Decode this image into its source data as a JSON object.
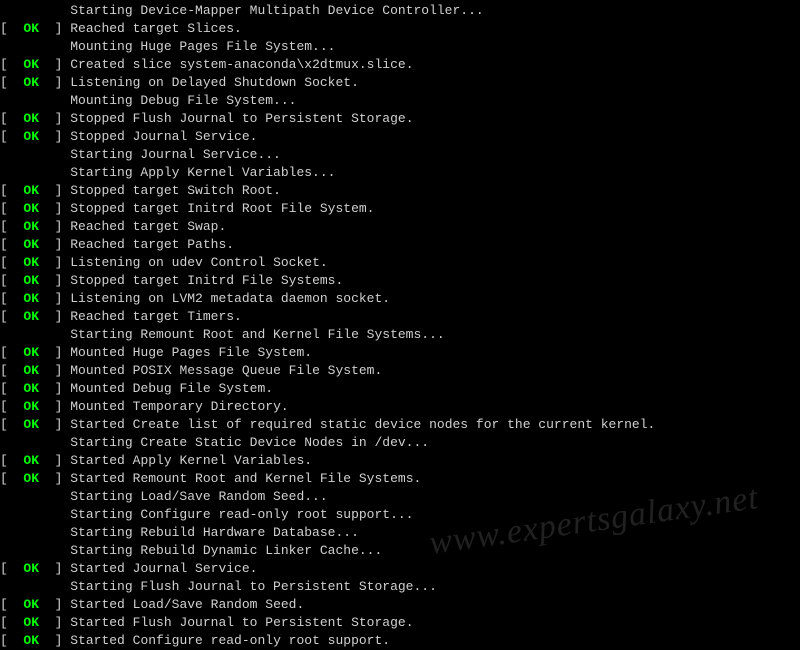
{
  "status_text": "OK",
  "lines": [
    {
      "ok": false,
      "msg": "Starting Device-Mapper Multipath Device Controller..."
    },
    {
      "ok": true,
      "msg": "Reached target Slices."
    },
    {
      "ok": false,
      "msg": "Mounting Huge Pages File System..."
    },
    {
      "ok": true,
      "msg": "Created slice system-anaconda\\x2dtmux.slice."
    },
    {
      "ok": true,
      "msg": "Listening on Delayed Shutdown Socket."
    },
    {
      "ok": false,
      "msg": "Mounting Debug File System..."
    },
    {
      "ok": true,
      "msg": "Stopped Flush Journal to Persistent Storage."
    },
    {
      "ok": true,
      "msg": "Stopped Journal Service."
    },
    {
      "ok": false,
      "msg": "Starting Journal Service..."
    },
    {
      "ok": false,
      "msg": "Starting Apply Kernel Variables..."
    },
    {
      "ok": true,
      "msg": "Stopped target Switch Root."
    },
    {
      "ok": true,
      "msg": "Stopped target Initrd Root File System."
    },
    {
      "ok": true,
      "msg": "Reached target Swap."
    },
    {
      "ok": true,
      "msg": "Reached target Paths."
    },
    {
      "ok": true,
      "msg": "Listening on udev Control Socket."
    },
    {
      "ok": true,
      "msg": "Stopped target Initrd File Systems."
    },
    {
      "ok": true,
      "msg": "Listening on LVM2 metadata daemon socket."
    },
    {
      "ok": true,
      "msg": "Reached target Timers."
    },
    {
      "ok": false,
      "msg": "Starting Remount Root and Kernel File Systems..."
    },
    {
      "ok": true,
      "msg": "Mounted Huge Pages File System."
    },
    {
      "ok": true,
      "msg": "Mounted POSIX Message Queue File System."
    },
    {
      "ok": true,
      "msg": "Mounted Debug File System."
    },
    {
      "ok": true,
      "msg": "Mounted Temporary Directory."
    },
    {
      "ok": true,
      "msg": "Started Create list of required static device nodes for the current kernel."
    },
    {
      "ok": false,
      "msg": "Starting Create Static Device Nodes in /dev..."
    },
    {
      "ok": true,
      "msg": "Started Apply Kernel Variables."
    },
    {
      "ok": true,
      "msg": "Started Remount Root and Kernel File Systems."
    },
    {
      "ok": false,
      "msg": "Starting Load/Save Random Seed..."
    },
    {
      "ok": false,
      "msg": "Starting Configure read-only root support..."
    },
    {
      "ok": false,
      "msg": "Starting Rebuild Hardware Database..."
    },
    {
      "ok": false,
      "msg": "Starting Rebuild Dynamic Linker Cache..."
    },
    {
      "ok": true,
      "msg": "Started Journal Service."
    },
    {
      "ok": false,
      "msg": "Starting Flush Journal to Persistent Storage..."
    },
    {
      "ok": true,
      "msg": "Started Load/Save Random Seed."
    },
    {
      "ok": true,
      "msg": "Started Flush Journal to Persistent Storage."
    },
    {
      "ok": true,
      "msg": "Started Configure read-only root support."
    }
  ],
  "watermark": "www.expertsgalaxy.net"
}
